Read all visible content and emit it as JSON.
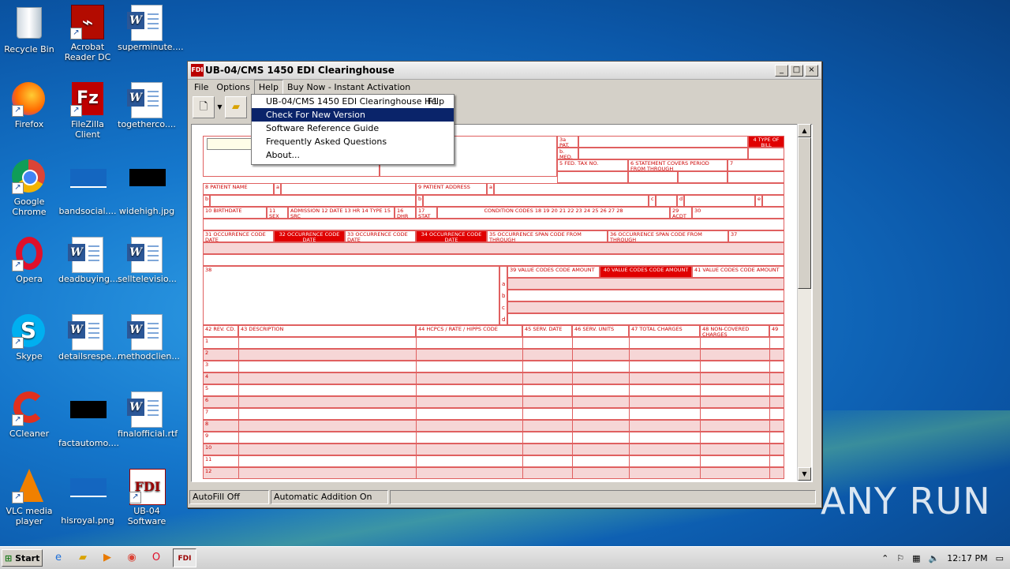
{
  "desktop": {
    "icons": [
      {
        "label": "Recycle Bin",
        "icon": "recycle-bin-icon"
      },
      {
        "label": "Acrobat Reader DC",
        "icon": "acrobat-icon"
      },
      {
        "label": "superminute....",
        "icon": "word-doc-icon"
      },
      {
        "label": "Firefox",
        "icon": "firefox-icon"
      },
      {
        "label": "FileZilla Client",
        "icon": "filezilla-icon"
      },
      {
        "label": "togetherco....",
        "icon": "word-doc-icon"
      },
      {
        "label": "Google Chrome",
        "icon": "chrome-icon"
      },
      {
        "label": "bandsocial....",
        "icon": "image-icon"
      },
      {
        "label": "widehigh.jpg",
        "icon": "image-icon"
      },
      {
        "label": "Opera",
        "icon": "opera-icon"
      },
      {
        "label": "deadbuying....",
        "icon": "word-doc-icon"
      },
      {
        "label": "selltelevisio...",
        "icon": "word-doc-icon"
      },
      {
        "label": "Skype",
        "icon": "skype-icon"
      },
      {
        "label": "detailsrespe...",
        "icon": "word-doc-icon"
      },
      {
        "label": "methodclien...",
        "icon": "word-doc-icon"
      },
      {
        "label": "CCleaner",
        "icon": "ccleaner-icon"
      },
      {
        "label": "factautomo....",
        "icon": "image-icon"
      },
      {
        "label": "finalofficial.rtf",
        "icon": "word-doc-icon"
      },
      {
        "label": "VLC media player",
        "icon": "vlc-icon"
      },
      {
        "label": "hisroyal.png",
        "icon": "image-icon"
      },
      {
        "label": "UB-04 Software",
        "icon": "ub04-icon"
      }
    ]
  },
  "window": {
    "title": "UB-04/CMS 1450 EDI Clearinghouse",
    "appicon": "FDI",
    "controls": {
      "minimize": "_",
      "maximize": "□",
      "close": "×"
    },
    "menu": {
      "file": "File",
      "options": "Options",
      "help": "Help",
      "buy": "Buy Now - Instant Activation"
    },
    "help_menu": {
      "items": [
        {
          "label": "UB-04/CMS 1450 EDI Clearinghouse Help",
          "shortcut": "F1"
        },
        {
          "label": "Check For New Version",
          "shortcut": ""
        },
        {
          "label": "Software Reference Guide",
          "shortcut": ""
        },
        {
          "label": "Frequently Asked Questions",
          "shortcut": ""
        },
        {
          "label": "About...",
          "shortcut": ""
        }
      ],
      "highlighted_index": 1
    },
    "status": {
      "autofill": "AutoFill Off",
      "auto_addition": "Automatic Addition On",
      "blank": ""
    }
  },
  "form": {
    "patcntl": "3a PAT. CNTL #",
    "medrec": "b. MED. REC. #",
    "typebill": "4 TYPE OF BILL",
    "fedtax": "5 FED. TAX NO.",
    "stmt": "6 STATEMENT COVERS PERIOD FROM THROUGH",
    "f7": "7",
    "patname": "8 PATIENT NAME",
    "patname_a": "a",
    "pataddr": "9 PATIENT ADDRESS",
    "pataddr_a": "a",
    "row_b1": "b",
    "row_b2": "b",
    "row_c": "c",
    "row_d": "d",
    "row_e": "e",
    "birthdate": "10 BIRTHDATE",
    "sex": "11 SEX",
    "admission": "ADMISSION 12 DATE 13 HR 14 TYPE 15 SRC",
    "dhr": "16 DHR",
    "stat": "17 STAT",
    "condcodes": "CONDITION CODES 18 19 20 21 22 23 24 25 26 27 28",
    "acdt": "29 ACDT STATE",
    "f30": "30",
    "occ31": "31 OCCURRENCE CODE DATE",
    "occ32": "32 OCCURRENCE CODE DATE",
    "occ33": "33 OCCURRENCE CODE DATE",
    "occ34": "34 OCCURRENCE CODE DATE",
    "span35": "35 OCCURRENCE SPAN CODE FROM THROUGH",
    "span36": "36 OCCURRENCE SPAN CODE FROM THROUGH",
    "f37": "37",
    "f38": "38",
    "val39": "39 VALUE CODES CODE AMOUNT",
    "val40": "40 VALUE CODES CODE AMOUNT",
    "val41": "41 VALUE CODES CODE AMOUNT",
    "letters": [
      "a",
      "b",
      "c",
      "d"
    ],
    "revcd": "42 REV. CD.",
    "desc": "43 DESCRIPTION",
    "hcpcs": "44 HCPCS / RATE / HIPPS CODE",
    "servdate": "45 SERV. DATE",
    "servunits": "46 SERV. UNITS",
    "totalch": "47 TOTAL CHARGES",
    "noncov": "48 NON-COVERED CHARGES",
    "f49": "49",
    "line_numbers": [
      "1",
      "2",
      "3",
      "4",
      "5",
      "6",
      "7",
      "8",
      "9",
      "10",
      "11",
      "12"
    ]
  },
  "watermark": "ANY RUN",
  "taskbar": {
    "start": "Start",
    "time": "12:17 PM"
  }
}
